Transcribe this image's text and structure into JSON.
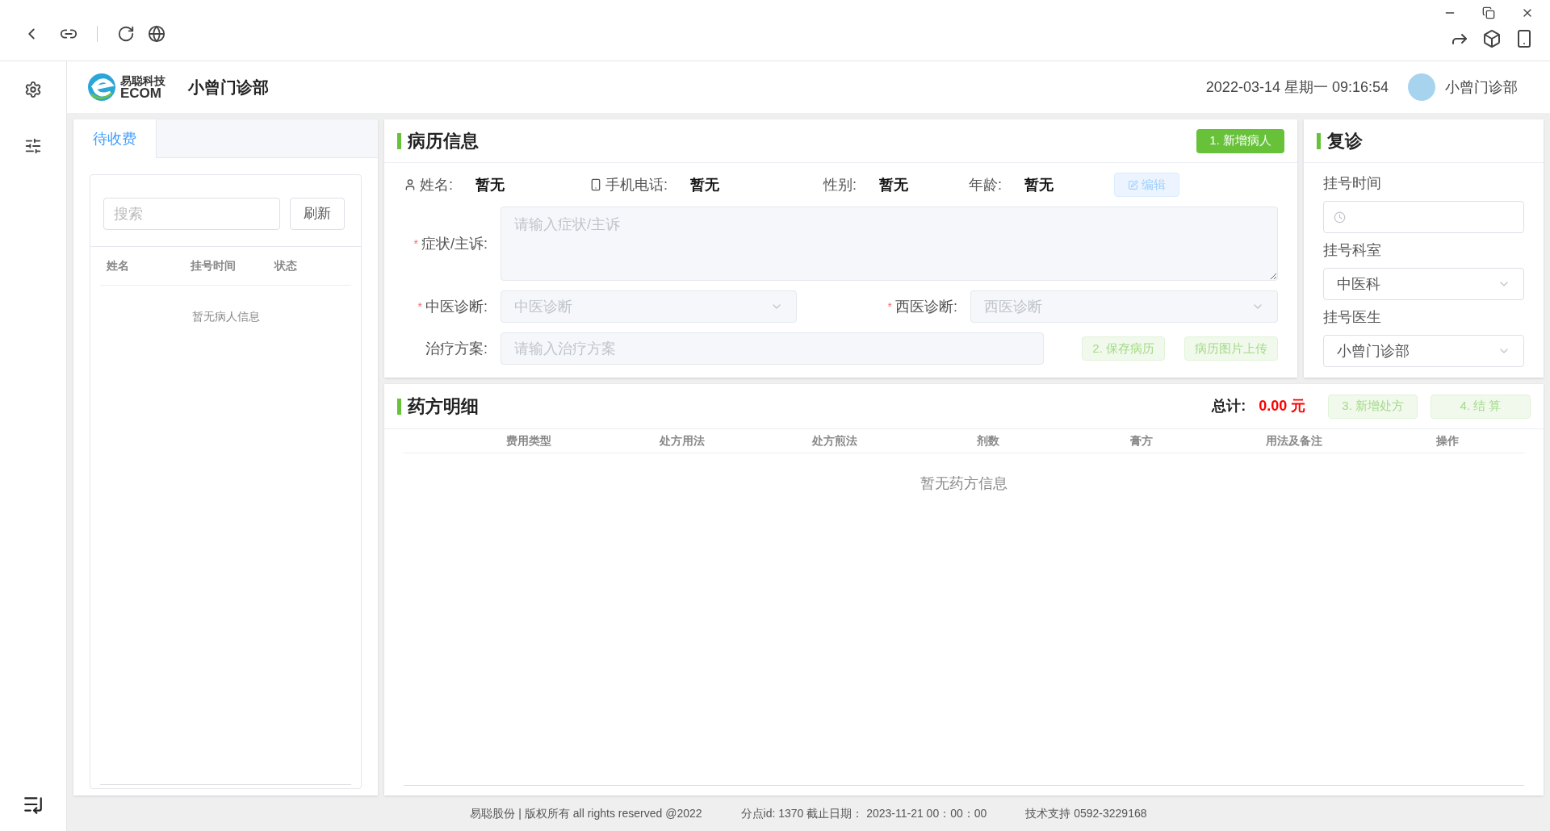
{
  "header": {
    "logo_cn": "易聪科技",
    "logo_en": "ECOM",
    "clinic": "小曾门诊部",
    "datetime": "2022-03-14 星期一 09:16:54",
    "user": "小曾门诊部"
  },
  "queue": {
    "tabs": [
      {
        "label": "待收费",
        "selected": true
      }
    ],
    "search": {
      "placeholder": "搜索"
    },
    "refresh": "刷新",
    "columns": [
      "姓名",
      "挂号时间",
      "状态"
    ],
    "empty": "暂无病人信息"
  },
  "record": {
    "title": "病历信息",
    "new_patient": "1. 新增病人",
    "info": [
      {
        "label": "姓名:",
        "value": "暂无"
      },
      {
        "label": "手机电话:",
        "value": "暂无"
      },
      {
        "label": "性别:",
        "value": "暂无"
      },
      {
        "label": "年龄:",
        "value": "暂无"
      }
    ],
    "edit": "编辑",
    "required_mark": "*",
    "symptom": {
      "label": "症状/主诉:",
      "required": true,
      "placeholder": "请输入症状/主诉"
    },
    "tcm": {
      "label": "中医诊断:",
      "required": true,
      "placeholder": "中医诊断"
    },
    "western": {
      "label": "西医诊断:",
      "required": true,
      "placeholder": "西医诊断"
    },
    "plan": {
      "label": "治疗方案:",
      "required": false,
      "placeholder": "请输入治疗方案"
    },
    "save": "2. 保存病历",
    "upload": "病历图片上传"
  },
  "revisit": {
    "title": "复诊",
    "fields": [
      {
        "label": "挂号时间",
        "kind": "time"
      },
      {
        "label": "挂号科室",
        "kind": "select",
        "value": "中医科"
      },
      {
        "label": "挂号医生",
        "kind": "select",
        "value": "小曾门诊部"
      }
    ]
  },
  "prescription": {
    "title": "药方明细",
    "total_label": "总计:",
    "total": "0.00 元",
    "add": "3. 新增处方",
    "settle": "4. 结 算",
    "columns": [
      "费用类型",
      "处方用法",
      "处方煎法",
      "剂数",
      "膏方",
      "用法及备注",
      "操作"
    ],
    "empty": "暂无药方信息"
  },
  "footer": [
    "易聪股份 | 版权所有 all rights reserved @2022",
    "分点id: 1370 截止日期： 2023-11-21 00：00：00",
    "技术支持 0592-3229168"
  ]
}
